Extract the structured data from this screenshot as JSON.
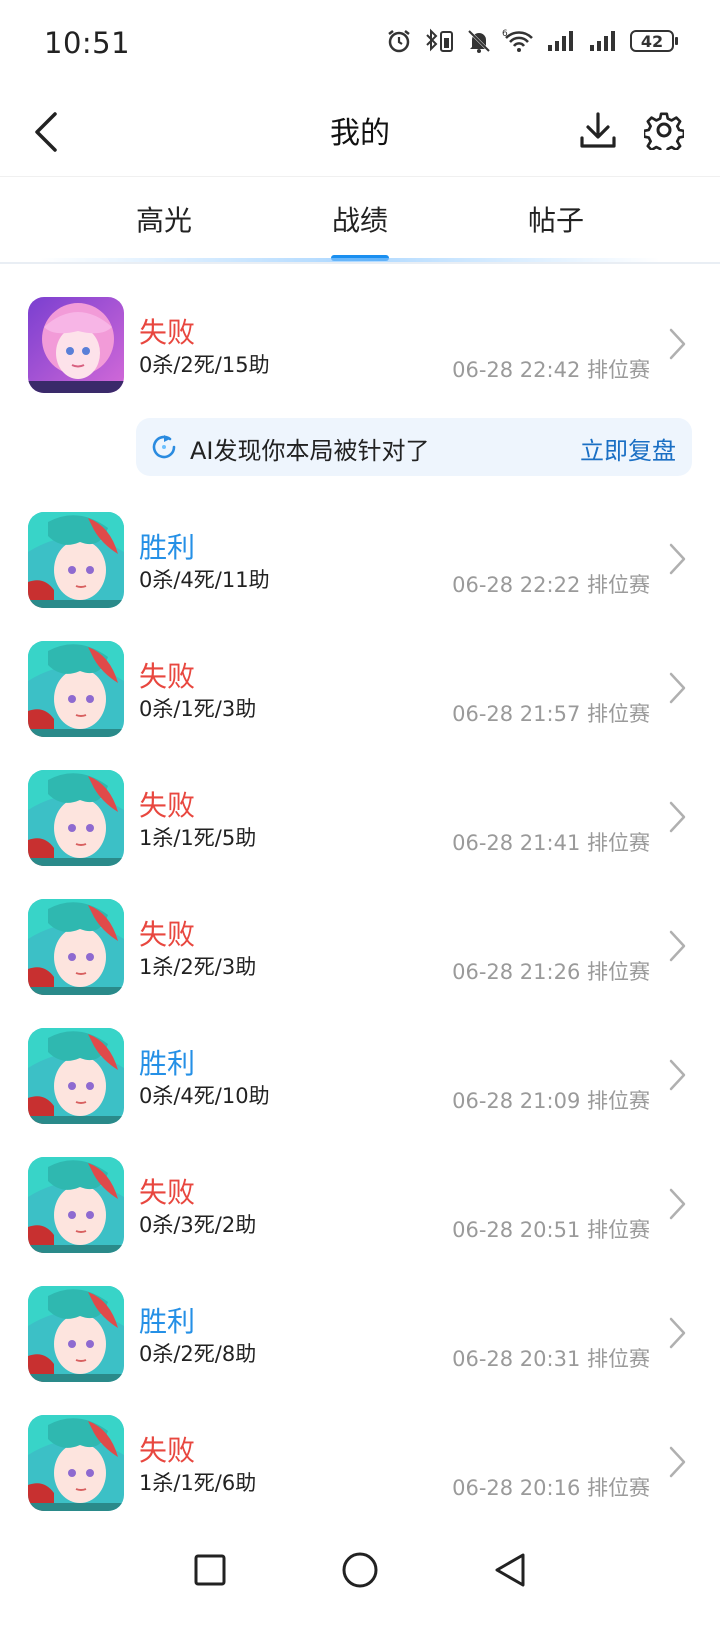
{
  "status_bar": {
    "time": "10:51",
    "battery": "42",
    "signal_label": "6"
  },
  "header": {
    "title": "我的"
  },
  "tabs": [
    {
      "label": "高光",
      "active": false
    },
    {
      "label": "战绩",
      "active": true
    },
    {
      "label": "帖子",
      "active": false
    }
  ],
  "ai_banner": {
    "text": "AI发现你本局被针对了",
    "action": "立即复盘"
  },
  "matches": [
    {
      "hero": "pink-hair-hero",
      "result": "失败",
      "outcome": "lose",
      "kda": "0杀/2死/15助",
      "meta": "06-28 22:42 排位赛"
    },
    {
      "hero": "teal-hair-hero",
      "result": "胜利",
      "outcome": "win",
      "kda": "0杀/4死/11助",
      "meta": "06-28 22:22 排位赛"
    },
    {
      "hero": "teal-hair-hero",
      "result": "失败",
      "outcome": "lose",
      "kda": "0杀/1死/3助",
      "meta": "06-28 21:57 排位赛"
    },
    {
      "hero": "teal-hair-hero",
      "result": "失败",
      "outcome": "lose",
      "kda": "1杀/1死/5助",
      "meta": "06-28 21:41 排位赛"
    },
    {
      "hero": "teal-hair-hero",
      "result": "失败",
      "outcome": "lose",
      "kda": "1杀/2死/3助",
      "meta": "06-28 21:26 排位赛"
    },
    {
      "hero": "teal-hair-hero",
      "result": "胜利",
      "outcome": "win",
      "kda": "0杀/4死/10助",
      "meta": "06-28 21:09 排位赛"
    },
    {
      "hero": "teal-hair-hero",
      "result": "失败",
      "outcome": "lose",
      "kda": "0杀/3死/2助",
      "meta": "06-28 20:51 排位赛"
    },
    {
      "hero": "teal-hair-hero",
      "result": "胜利",
      "outcome": "win",
      "kda": "0杀/2死/8助",
      "meta": "06-28 20:31 排位赛"
    },
    {
      "hero": "teal-hair-hero",
      "result": "失败",
      "outcome": "lose",
      "kda": "1杀/1死/6助",
      "meta": "06-28 20:16 排位赛"
    }
  ],
  "colors": {
    "win": "#2590e6",
    "lose": "#e8473f",
    "accent": "#1a8ff0",
    "banner_bg": "#eef5fd"
  },
  "nav": {
    "icons": [
      "recent-apps-icon",
      "home-icon",
      "back-icon"
    ]
  }
}
